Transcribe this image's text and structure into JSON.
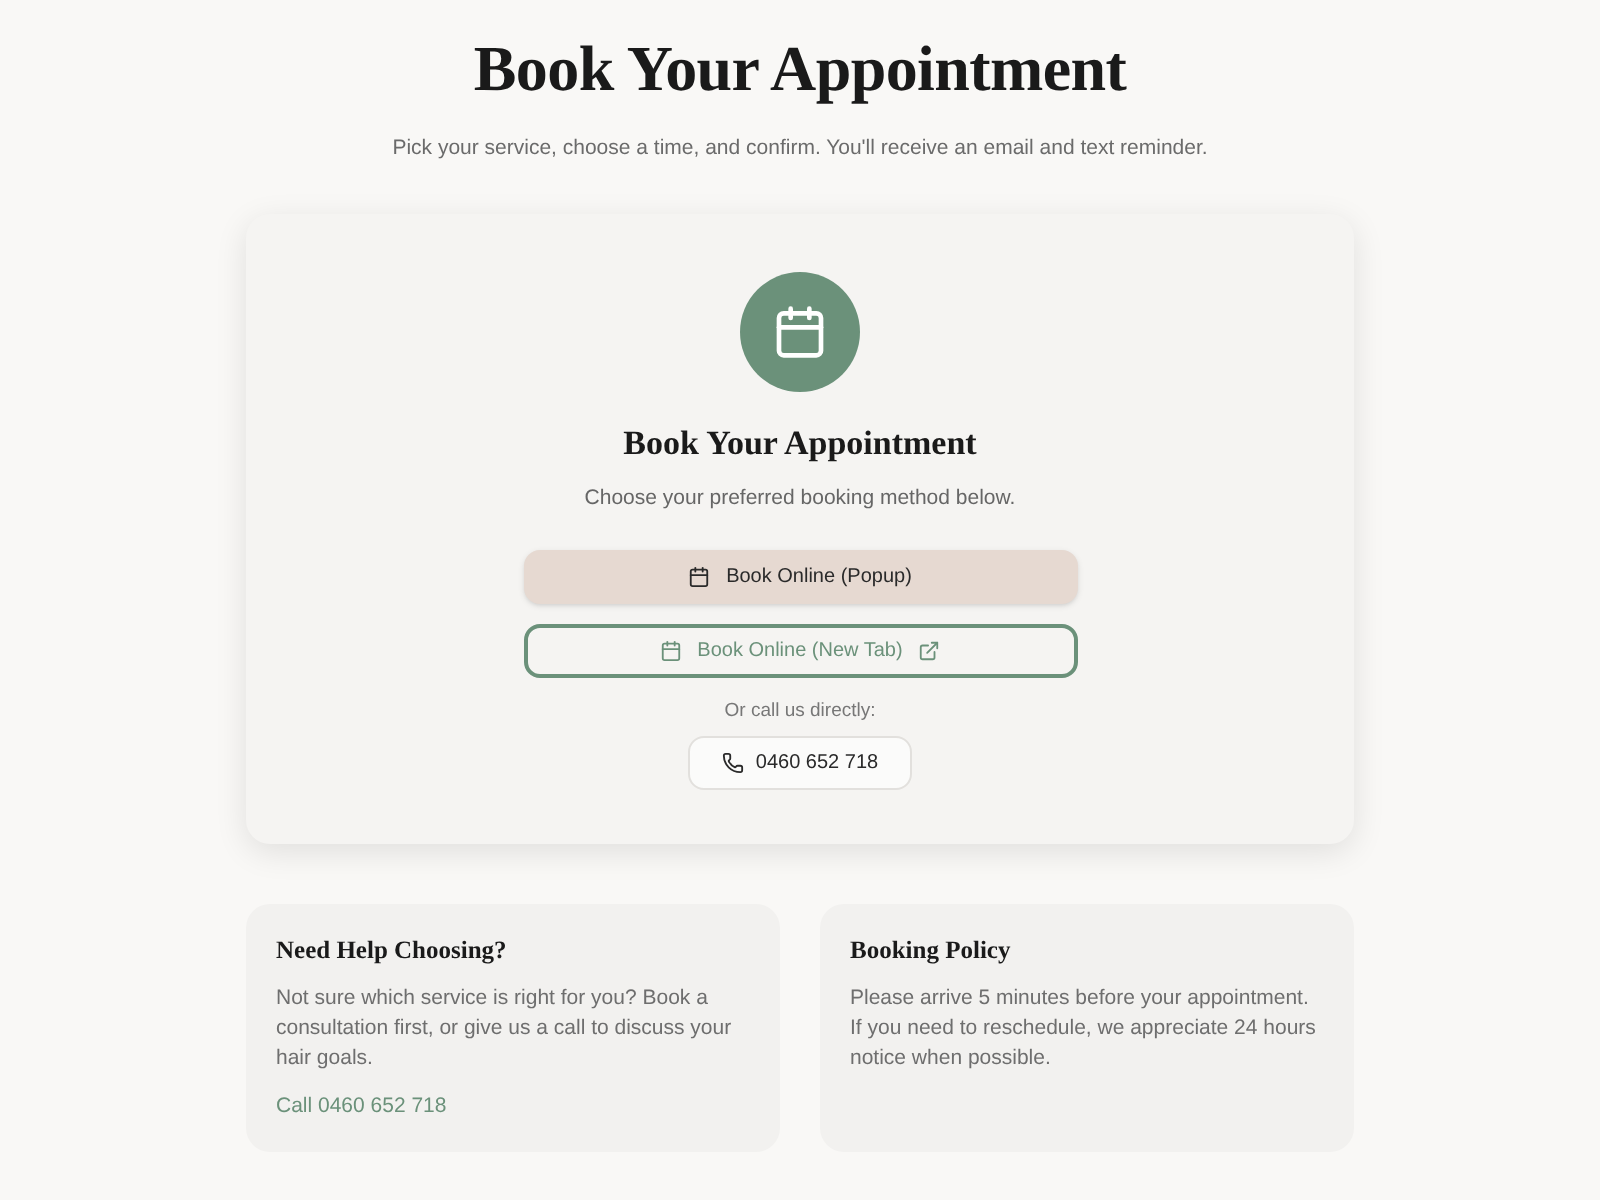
{
  "header": {
    "title": "Book Your Appointment",
    "subtitle": "Pick your service, choose a time, and confirm. You'll receive an email and text reminder."
  },
  "booking_card": {
    "title": "Book Your Appointment",
    "description": "Choose your preferred booking method below.",
    "buttons": [
      {
        "kind": "primary",
        "label": "Book Online (Popup)",
        "external": false
      },
      {
        "kind": "outline",
        "label": "Book Online (New Tab)",
        "external": true
      }
    ],
    "call_prompt": "Or call us directly:",
    "phone_button": "0460 652 718"
  },
  "info_cards": [
    {
      "title": "Need Help Choosing?",
      "body": "Not sure which service is right for you? Book a consultation first, or give us a call to discuss your hair goals.",
      "link": "Call 0460 652 718"
    },
    {
      "title": "Booking Policy",
      "body": "Please arrive 5 minutes before your appointment. If you need to reschedule, we appreciate 24 hours notice when possible."
    }
  ]
}
